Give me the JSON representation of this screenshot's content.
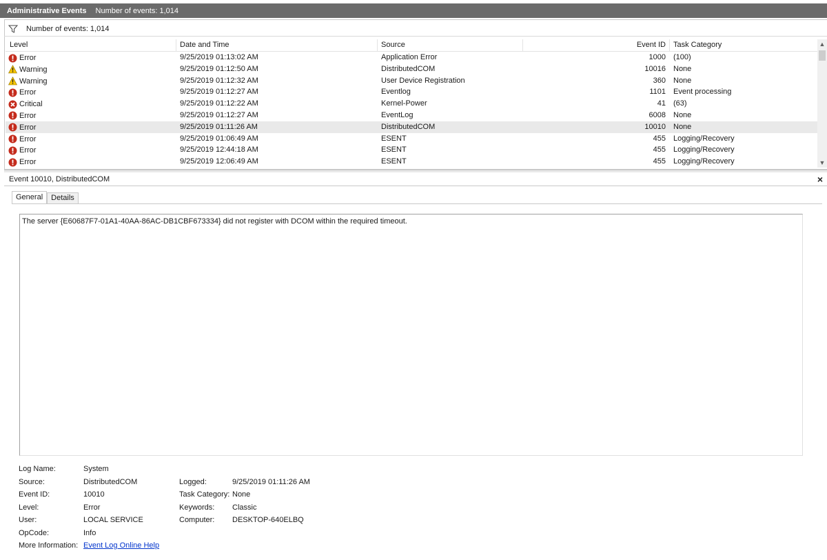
{
  "window": {
    "title": "Administrative Events",
    "event_count_label": "Number of events: 1,014"
  },
  "filter": {
    "label": "Number of events: 1,014",
    "icon": "funnel-icon"
  },
  "grid": {
    "columns": [
      "Level",
      "Date and Time",
      "Source",
      "Event ID",
      "Task Category"
    ],
    "rows": [
      {
        "level": "Error",
        "icon": "error-icon",
        "date": "9/25/2019 01:13:02 AM",
        "source": "Application Error",
        "id": "1000",
        "category": "(100)"
      },
      {
        "level": "Warning",
        "icon": "warning-icon",
        "date": "9/25/2019 01:12:50 AM",
        "source": "DistributedCOM",
        "id": "10016",
        "category": "None"
      },
      {
        "level": "Warning",
        "icon": "warning-icon",
        "date": "9/25/2019 01:12:32 AM",
        "source": "User Device Registration",
        "id": "360",
        "category": "None"
      },
      {
        "level": "Error",
        "icon": "error-icon",
        "date": "9/25/2019 01:12:27 AM",
        "source": "Eventlog",
        "id": "1101",
        "category": "Event processing"
      },
      {
        "level": "Critical",
        "icon": "critical-icon",
        "date": "9/25/2019 01:12:22 AM",
        "source": "Kernel-Power",
        "id": "41",
        "category": "(63)"
      },
      {
        "level": "Error",
        "icon": "error-icon",
        "date": "9/25/2019 01:12:27 AM",
        "source": "EventLog",
        "id": "6008",
        "category": "None"
      },
      {
        "level": "Error",
        "icon": "error-icon",
        "date": "9/25/2019 01:11:26 AM",
        "source": "DistributedCOM",
        "id": "10010",
        "category": "None",
        "selected": true
      },
      {
        "level": "Error",
        "icon": "error-icon",
        "date": "9/25/2019 01:06:49 AM",
        "source": "ESENT",
        "id": "455",
        "category": "Logging/Recovery"
      },
      {
        "level": "Error",
        "icon": "error-icon",
        "date": "9/25/2019 12:44:18 AM",
        "source": "ESENT",
        "id": "455",
        "category": "Logging/Recovery"
      },
      {
        "level": "Error",
        "icon": "error-icon",
        "date": "9/25/2019 12:06:49 AM",
        "source": "ESENT",
        "id": "455",
        "category": "Logging/Recovery"
      }
    ]
  },
  "detail": {
    "title": "Event 10010, DistributedCOM",
    "close": "×",
    "tabs": [
      "General",
      "Details"
    ],
    "description": "The server {E60687F7-01A1-40AA-86AC-DB1CBF673334} did not register with DCOM within the required timeout.",
    "props": {
      "log_name_label": "Log Name:",
      "log_name": "System",
      "source_label": "Source:",
      "source": "DistributedCOM",
      "logged_label": "Logged:",
      "logged": "9/25/2019 01:11:26 AM",
      "event_id_label": "Event ID:",
      "event_id": "10010",
      "task_category_label": "Task Category:",
      "task_category": "None",
      "level_label": "Level:",
      "level": "Error",
      "keywords_label": "Keywords:",
      "keywords": "Classic",
      "user_label": "User:",
      "user": "LOCAL SERVICE",
      "computer_label": "Computer:",
      "computer": "DESKTOP-640ELBQ",
      "opcode_label": "OpCode:",
      "opcode": "Info",
      "more_info_label": "More Information:",
      "more_info_link": "Event Log Online Help"
    }
  },
  "colors": {
    "titlebar": "#6b6b6b",
    "error": "#c42b1c",
    "warning": "#f7c600",
    "link": "#0033cc",
    "selected_row": "#e9e9e9"
  }
}
